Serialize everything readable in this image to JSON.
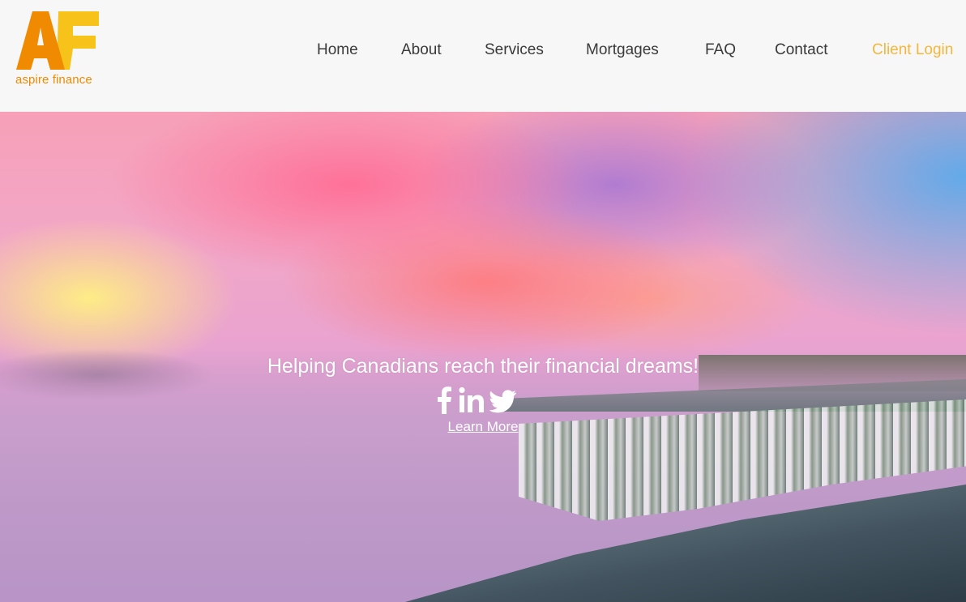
{
  "header": {
    "logo_text": "aspire finance",
    "logo_mark": "AF",
    "nav": [
      {
        "label": "Home"
      },
      {
        "label": "About"
      },
      {
        "label": "Services"
      },
      {
        "label": "Mortgages"
      },
      {
        "label": "FAQ"
      },
      {
        "label": "Contact"
      },
      {
        "label": "Client Login"
      }
    ]
  },
  "hero": {
    "tagline": "Helping Canadians reach their financial dreams!",
    "social_icons": [
      "facebook-icon",
      "linkedin-icon",
      "twitter-icon"
    ],
    "cta_label": "Learn More"
  },
  "colors": {
    "logo_orange": "#f08a00",
    "logo_yellow": "#f7c21a",
    "nav_text": "#3a3a3a",
    "client_login": "#f4b73a",
    "hero_text": "#ffffff"
  }
}
